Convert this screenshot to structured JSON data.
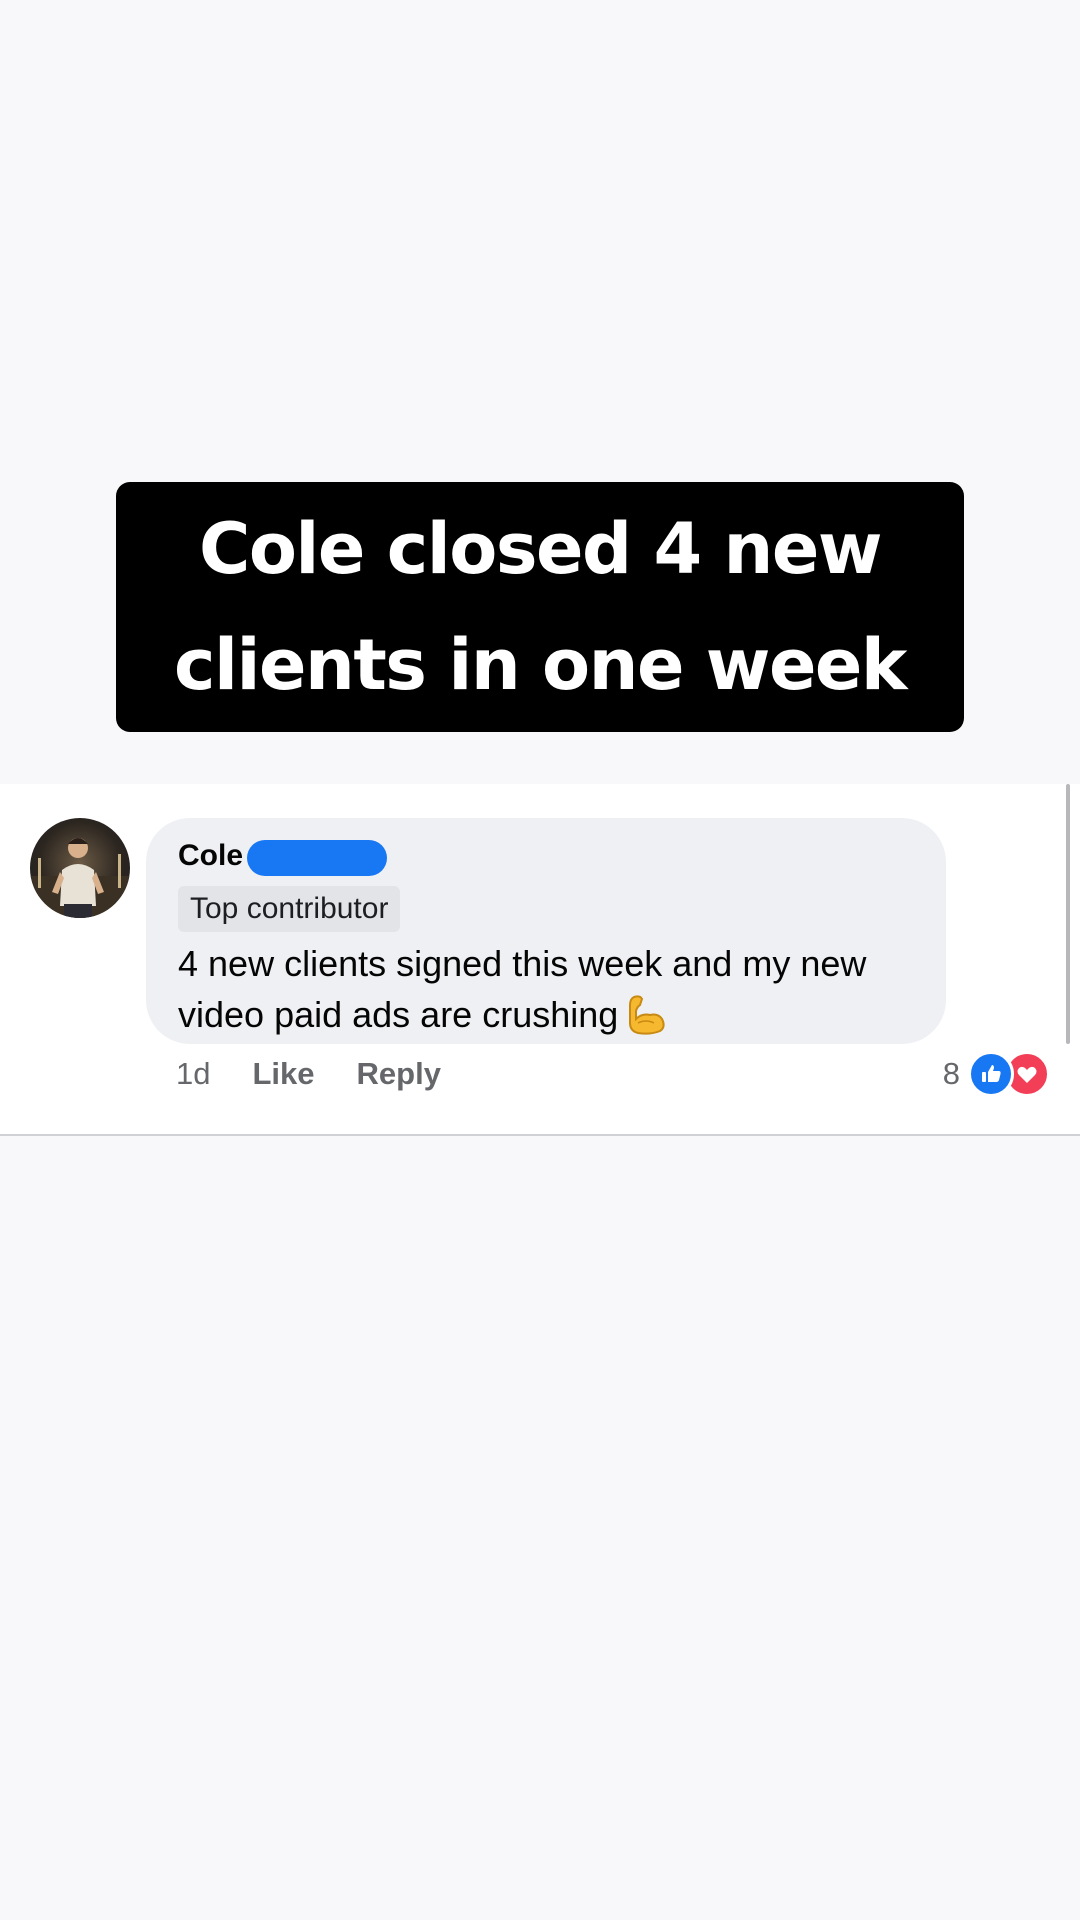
{
  "headline": {
    "line1": "Cole closed 4 new",
    "line2": "clients in one week"
  },
  "comment": {
    "author": "Cole",
    "badge": "Top contributor",
    "text": "4 new clients signed this week and my new video paid ads are crushing",
    "emoji": "flexed-biceps-icon",
    "time": "1d",
    "like_label": "Like",
    "reply_label": "Reply",
    "reaction_count": "8",
    "reactions": [
      "like-icon",
      "love-icon"
    ]
  },
  "colors": {
    "page_background": "#f8f8fa",
    "headline_background": "#000000",
    "headline_text": "#ffffff",
    "bubble_background": "#eef0f3",
    "redaction_scribble": "#1877f2",
    "meta_text": "#65676b",
    "like_blue": "#1877f2",
    "love_red": "#f33e58"
  }
}
